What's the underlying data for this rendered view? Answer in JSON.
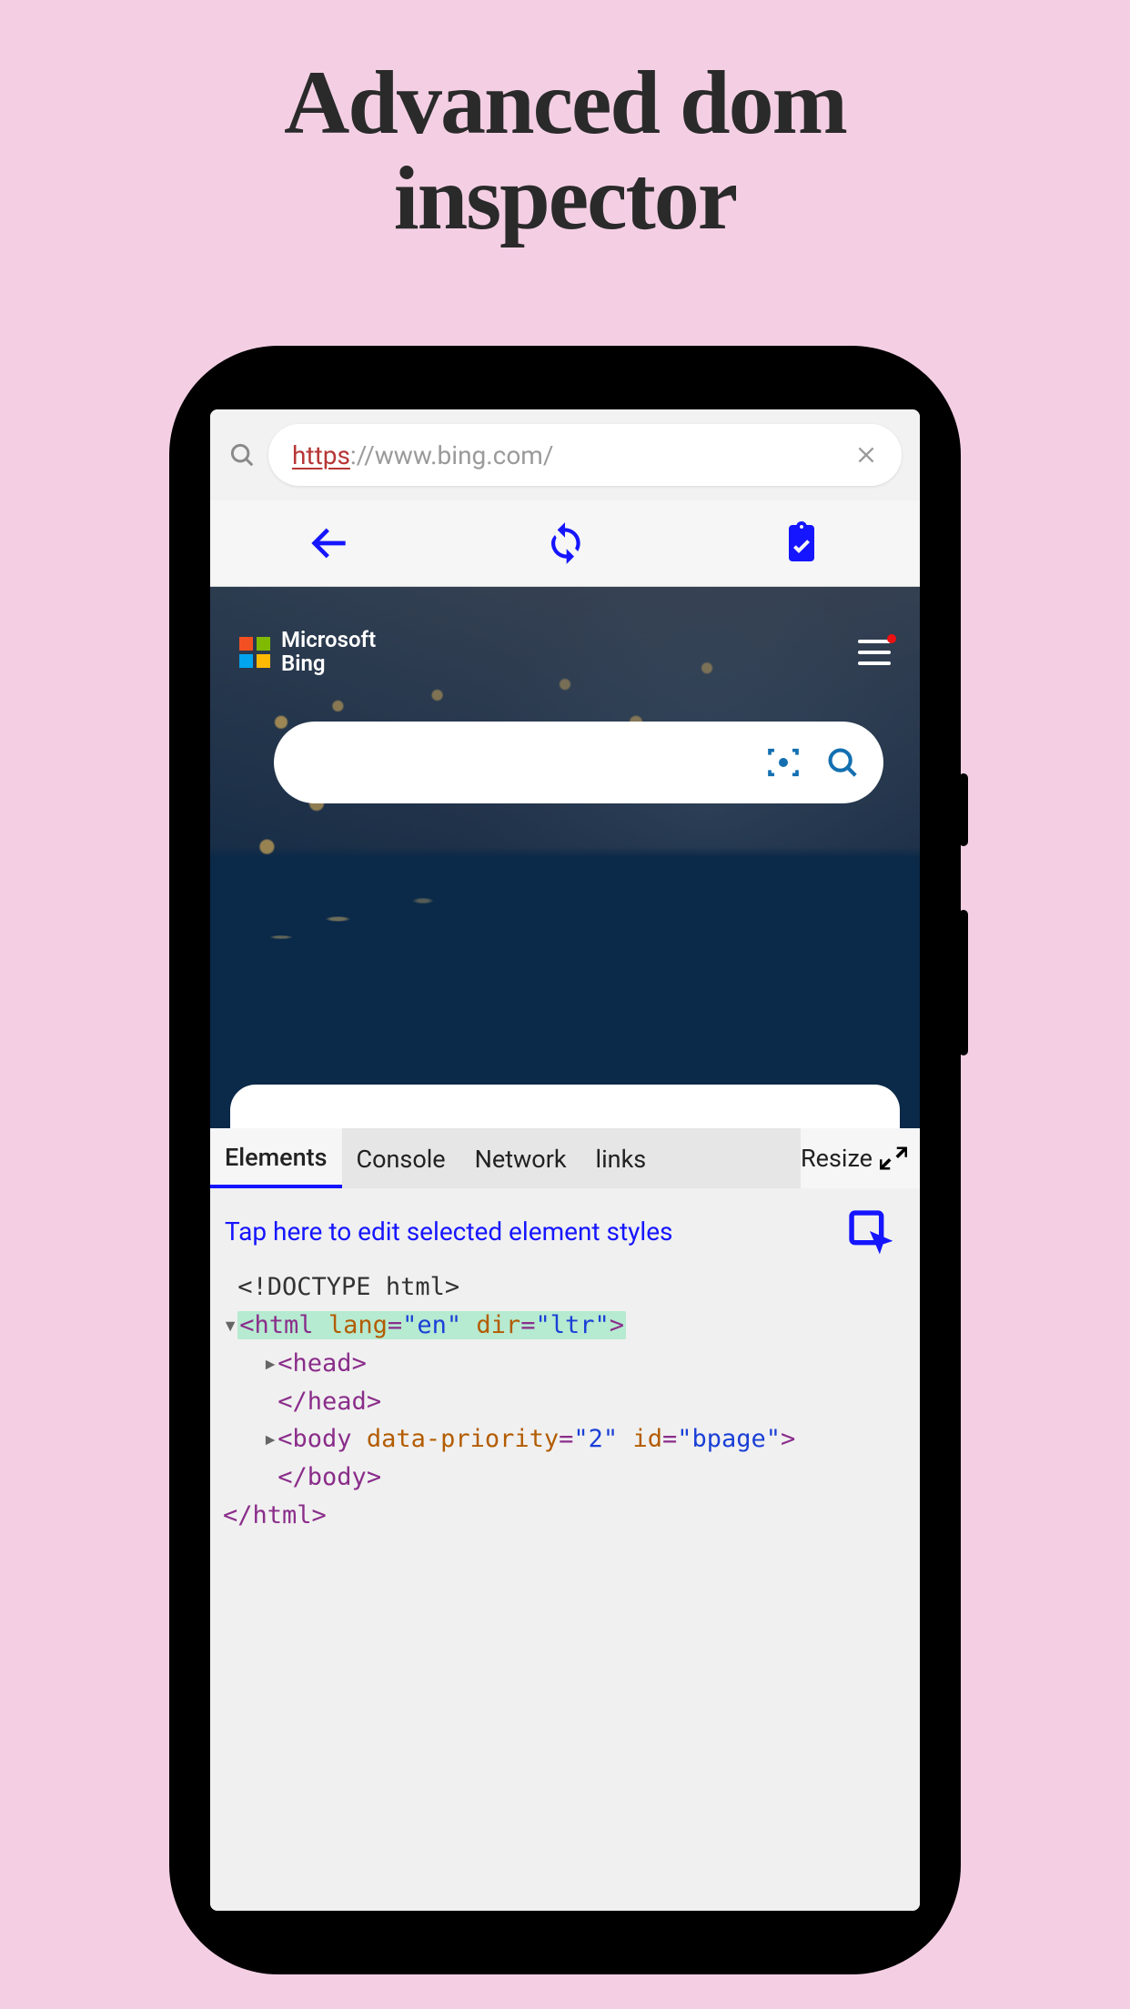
{
  "headline_line1": "Advanced dom",
  "headline_line2": "inspector",
  "urlbar": {
    "protocol": "https",
    "rest": "://www.bing.com/"
  },
  "bing": {
    "brand_line1": "Microsoft",
    "brand_line2": "Bing"
  },
  "inspector": {
    "tabs": {
      "elements": "Elements",
      "console": "Console",
      "network": "Network",
      "links": "links"
    },
    "resize_label": "Resize",
    "hint": "Tap here to edit selected element styles",
    "dom": {
      "doctype": "<!DOCTYPE html>",
      "html_open_tag": "html",
      "html_lang_attr": "lang",
      "html_lang_val": "\"en\"",
      "html_dir_attr": "dir",
      "html_dir_val": "\"ltr\"",
      "head_tag": "head",
      "head_close": "head",
      "body_tag": "body",
      "body_attr1": "data-priority",
      "body_val1": "\"2\"",
      "body_attr2": "id",
      "body_val2": "\"bpage\"",
      "body_close": "body",
      "html_close": "html"
    }
  }
}
